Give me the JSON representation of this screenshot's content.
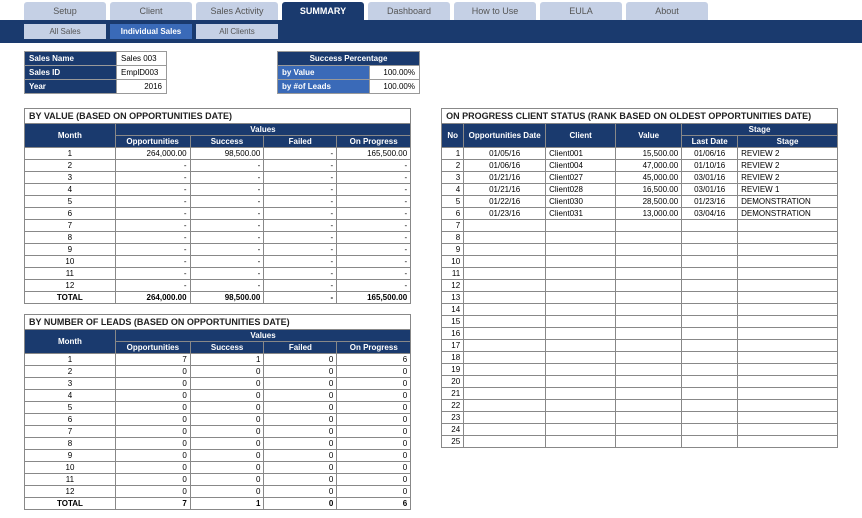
{
  "tabs": [
    "Setup",
    "Client",
    "Sales Activity",
    "SUMMARY",
    "Dashboard",
    "How to Use",
    "EULA",
    "About"
  ],
  "activeTab": 3,
  "subtabs": [
    "All Sales",
    "Individual Sales",
    "All Clients"
  ],
  "activeSub": 1,
  "info": {
    "salesNameLabel": "Sales Name",
    "salesName": "Sales 003",
    "salesIdLabel": "Sales ID",
    "salesId": "EmplD003",
    "yearLabel": "Year",
    "year": "2016",
    "succPctLabel": "Success Percentage",
    "byValueLabel": "by Value",
    "byValue": "100.00%",
    "byLeadsLabel": "by #of Leads",
    "byLeads": "100.00%"
  },
  "byValue": {
    "title": "BY VALUE (BASED ON OPPORTUNITIES DATE)",
    "headers": {
      "month": "Month",
      "values": "Values",
      "opp": "Opportunities",
      "suc": "Success",
      "fail": "Failed",
      "prog": "On Progress"
    },
    "rows": [
      {
        "m": "1",
        "o": "264,000.00",
        "s": "98,500.00",
        "f": "-",
        "p": "165,500.00"
      },
      {
        "m": "2",
        "o": "-",
        "s": "-",
        "f": "-",
        "p": "-"
      },
      {
        "m": "3",
        "o": "-",
        "s": "-",
        "f": "-",
        "p": "-"
      },
      {
        "m": "4",
        "o": "-",
        "s": "-",
        "f": "-",
        "p": "-"
      },
      {
        "m": "5",
        "o": "-",
        "s": "-",
        "f": "-",
        "p": "-"
      },
      {
        "m": "6",
        "o": "-",
        "s": "-",
        "f": "-",
        "p": "-"
      },
      {
        "m": "7",
        "o": "-",
        "s": "-",
        "f": "-",
        "p": "-"
      },
      {
        "m": "8",
        "o": "-",
        "s": "-",
        "f": "-",
        "p": "-"
      },
      {
        "m": "9",
        "o": "-",
        "s": "-",
        "f": "-",
        "p": "-"
      },
      {
        "m": "10",
        "o": "-",
        "s": "-",
        "f": "-",
        "p": "-"
      },
      {
        "m": "11",
        "o": "-",
        "s": "-",
        "f": "-",
        "p": "-"
      },
      {
        "m": "12",
        "o": "-",
        "s": "-",
        "f": "-",
        "p": "-"
      }
    ],
    "total": {
      "label": "TOTAL",
      "o": "264,000.00",
      "s": "98,500.00",
      "f": "-",
      "p": "165,500.00"
    }
  },
  "byLeads": {
    "title": "BY NUMBER OF LEADS (BASED ON OPPORTUNITIES DATE)",
    "headers": {
      "month": "Month",
      "values": "Values",
      "opp": "Opportunities",
      "suc": "Success",
      "fail": "Failed",
      "prog": "On Progress"
    },
    "rows": [
      {
        "m": "1",
        "o": "7",
        "s": "1",
        "f": "0",
        "p": "6"
      },
      {
        "m": "2",
        "o": "0",
        "s": "0",
        "f": "0",
        "p": "0"
      },
      {
        "m": "3",
        "o": "0",
        "s": "0",
        "f": "0",
        "p": "0"
      },
      {
        "m": "4",
        "o": "0",
        "s": "0",
        "f": "0",
        "p": "0"
      },
      {
        "m": "5",
        "o": "0",
        "s": "0",
        "f": "0",
        "p": "0"
      },
      {
        "m": "6",
        "o": "0",
        "s": "0",
        "f": "0",
        "p": "0"
      },
      {
        "m": "7",
        "o": "0",
        "s": "0",
        "f": "0",
        "p": "0"
      },
      {
        "m": "8",
        "o": "0",
        "s": "0",
        "f": "0",
        "p": "0"
      },
      {
        "m": "9",
        "o": "0",
        "s": "0",
        "f": "0",
        "p": "0"
      },
      {
        "m": "10",
        "o": "0",
        "s": "0",
        "f": "0",
        "p": "0"
      },
      {
        "m": "11",
        "o": "0",
        "s": "0",
        "f": "0",
        "p": "0"
      },
      {
        "m": "12",
        "o": "0",
        "s": "0",
        "f": "0",
        "p": "0"
      }
    ],
    "total": {
      "label": "TOTAL",
      "o": "7",
      "s": "1",
      "f": "0",
      "p": "6"
    }
  },
  "progress": {
    "title": "ON PROGRESS CLIENT STATUS (RANK BASED ON OLDEST OPPORTUNITIES DATE)",
    "headers": {
      "no": "No",
      "date": "Opportunities Date",
      "client": "Client",
      "value": "Value",
      "stageGroup": "Stage",
      "last": "Last Date",
      "stage": "Stage"
    },
    "rows": [
      {
        "n": "1",
        "d": "01/05/16",
        "c": "Client001",
        "v": "15,500.00",
        "l": "01/06/16",
        "s": "REVIEW 2"
      },
      {
        "n": "2",
        "d": "01/06/16",
        "c": "Client004",
        "v": "47,000.00",
        "l": "01/10/16",
        "s": "REVIEW 2"
      },
      {
        "n": "3",
        "d": "01/21/16",
        "c": "Client027",
        "v": "45,000.00",
        "l": "03/01/16",
        "s": "REVIEW 2"
      },
      {
        "n": "4",
        "d": "01/21/16",
        "c": "Client028",
        "v": "16,500.00",
        "l": "03/01/16",
        "s": "REVIEW 1"
      },
      {
        "n": "5",
        "d": "01/22/16",
        "c": "Client030",
        "v": "28,500.00",
        "l": "01/23/16",
        "s": "DEMONSTRATION"
      },
      {
        "n": "6",
        "d": "01/23/16",
        "c": "Client031",
        "v": "13,000.00",
        "l": "03/04/16",
        "s": "DEMONSTRATION"
      }
    ],
    "emptyCount": 19
  }
}
